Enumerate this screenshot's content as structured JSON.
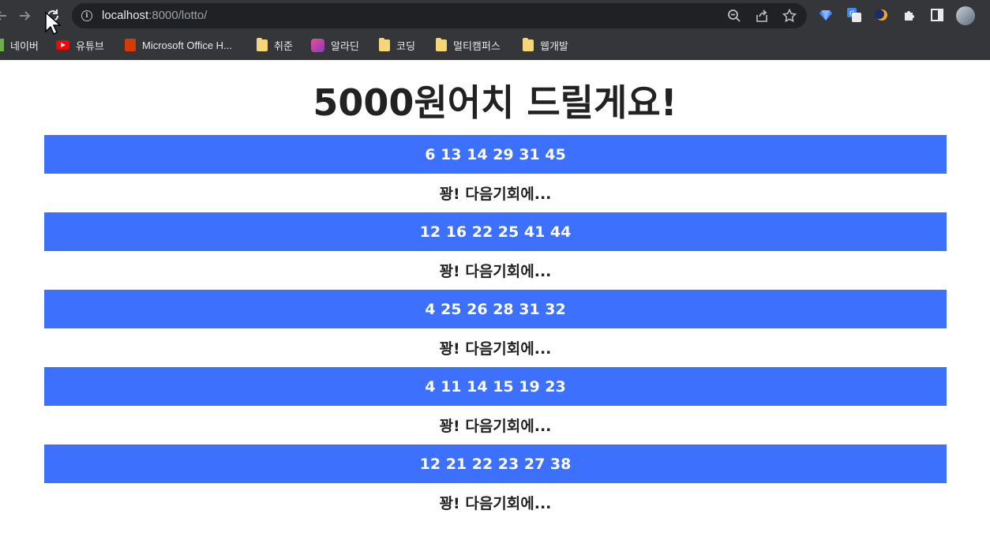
{
  "browser": {
    "url_host": "localhost",
    "url_path": ":8000/lotto/"
  },
  "bookmarks": [
    {
      "label": "네이버",
      "icon": "green-bar-icon"
    },
    {
      "label": "유튜브",
      "icon": "youtube-icon"
    },
    {
      "label": "Microsoft Office H...",
      "icon": "office-icon"
    },
    {
      "label": "취준",
      "icon": "folder-icon"
    },
    {
      "label": "알라딘",
      "icon": "aladin-icon"
    },
    {
      "label": "코딩",
      "icon": "folder-icon"
    },
    {
      "label": "멀티캠퍼스",
      "icon": "folder-icon"
    },
    {
      "label": "웹개발",
      "icon": "folder-icon"
    }
  ],
  "page": {
    "title": "5000원어치 드릴게요!",
    "results": [
      {
        "numbers": "6 13 14 29 31 45",
        "result": "꽝! 다음기회에..."
      },
      {
        "numbers": "12 16 22 25 41 44",
        "result": "꽝! 다음기회에..."
      },
      {
        "numbers": "4 25 26 28 31 32",
        "result": "꽝! 다음기회에..."
      },
      {
        "numbers": "4 11 14 15 19 23",
        "result": "꽝! 다음기회에..."
      },
      {
        "numbers": "12 21 22 23 27 38",
        "result": "꽝! 다음기회에..."
      }
    ]
  },
  "colors": {
    "chrome_bg": "#35363a",
    "omnibox_bg": "#202124",
    "number_row_bg": "#3d70fc",
    "title_text": "#222222"
  }
}
